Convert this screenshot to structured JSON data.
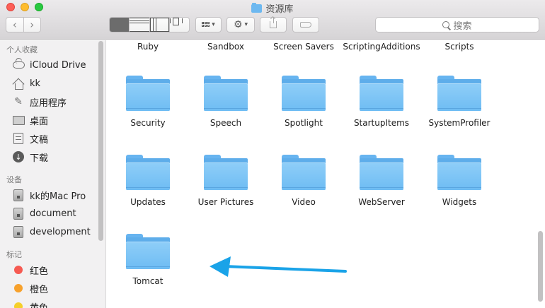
{
  "window": {
    "title": "资源库"
  },
  "toolbar": {
    "nav_back": "‹",
    "nav_forward": "›",
    "search_placeholder": "搜索"
  },
  "sidebar": {
    "sections": [
      {
        "title": "个人收藏",
        "items": [
          {
            "label": "iCloud Drive",
            "icon": "cloud-icon"
          },
          {
            "label": "kk",
            "icon": "home-icon"
          },
          {
            "label": "应用程序",
            "icon": "applications-icon"
          },
          {
            "label": "桌面",
            "icon": "desktop-icon"
          },
          {
            "label": "文稿",
            "icon": "document-icon"
          },
          {
            "label": "下载",
            "icon": "download-icon"
          }
        ]
      },
      {
        "title": "设备",
        "items": [
          {
            "label": "kk的Mac Pro",
            "icon": "disk-icon"
          },
          {
            "label": "document",
            "icon": "disk-icon"
          },
          {
            "label": "development",
            "icon": "disk-icon"
          }
        ]
      },
      {
        "title": "标记",
        "items": [
          {
            "label": "红色",
            "color": "#f65a52"
          },
          {
            "label": "橙色",
            "color": "#f7a12c"
          },
          {
            "label": "黄色",
            "color": "#f5cf2a"
          }
        ]
      }
    ]
  },
  "content": {
    "items": [
      "Ruby",
      "Sandbox",
      "Screen Savers",
      "ScriptingAdditions",
      "Scripts",
      "Security",
      "Speech",
      "Spotlight",
      "StartupItems",
      "SystemProfiler",
      "Updates",
      "User Pictures",
      "Video",
      "WebServer",
      "Widgets",
      "Tomcat"
    ]
  },
  "annotation": {
    "arrow_color": "#1aa3e8"
  }
}
